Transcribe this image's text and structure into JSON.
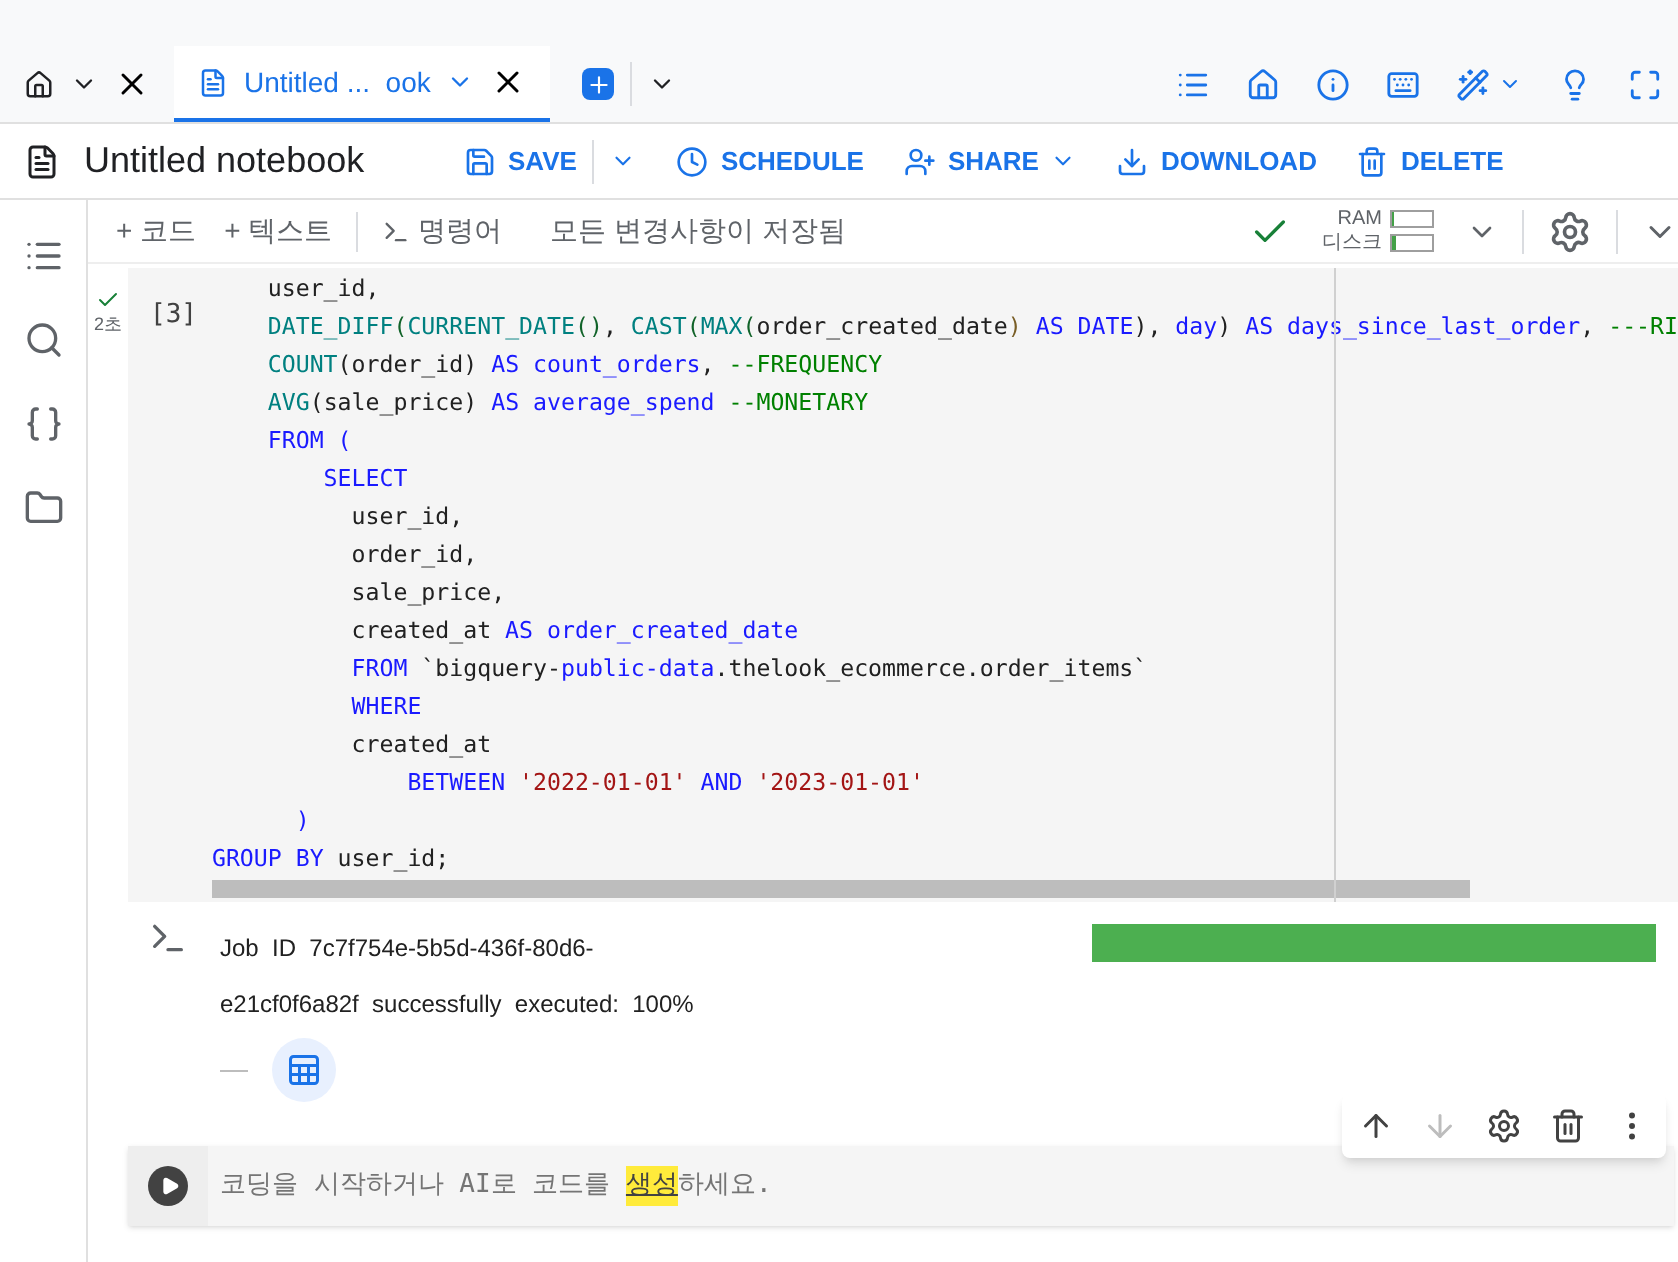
{
  "tabs": [
    {
      "kind": "home",
      "selected": false
    },
    {
      "kind": "notebook",
      "label": "Untitled ...  ook",
      "selected": true
    }
  ],
  "header": {
    "title": "Untitled notebook",
    "actions": [
      {
        "kind": "save",
        "label": "SAVE"
      },
      {
        "kind": "schedule",
        "label": "SCHEDULE"
      },
      {
        "kind": "share",
        "label": "SHARE"
      },
      {
        "kind": "download",
        "label": "DOWNLOAD"
      },
      {
        "kind": "delete",
        "label": "DELETE"
      }
    ]
  },
  "toolbar": {
    "add_code": "+ 코드",
    "add_text": "+ 텍스트",
    "command": "명령어",
    "save_status": "모든 변경사항이 저장됨",
    "ram_label": "RAM",
    "disk_label": "디스크",
    "ram": {
      "level": 0.05
    },
    "disk": {
      "level": 0.08
    }
  },
  "cell": {
    "run_time": "2초",
    "exec_count": "[3]",
    "lines": [
      [
        {
          "t": "    user_id,",
          "kind": "plain"
        }
      ],
      [
        {
          "t": "    DATE_DIFF",
          "kind": "func"
        },
        {
          "t": "(",
          "kind": "punct"
        },
        {
          "t": "CURRENT_DATE",
          "kind": "func"
        },
        {
          "t": "()",
          "kind": "punct"
        },
        {
          "t": ", ",
          "kind": "plain"
        },
        {
          "t": "CAST",
          "kind": "func"
        },
        {
          "t": "(",
          "kind": "punct"
        },
        {
          "t": "MAX",
          "kind": "func"
        },
        {
          "t": "(",
          "kind": "punct"
        },
        {
          "t": "order_created_date",
          "kind": "plain"
        },
        {
          "t": ")",
          "kind": "brace"
        },
        {
          "t": " AS DATE",
          "kind": "kw"
        },
        {
          "t": "), ",
          "kind": "plain"
        },
        {
          "t": "day",
          "kind": "kw"
        },
        {
          "t": ")",
          "kind": "plain"
        },
        {
          "t": " AS days_since_last_order",
          "kind": "kw"
        },
        {
          "t": ", ",
          "kind": "plain"
        },
        {
          "t": "---RI",
          "kind": "comment"
        }
      ],
      [
        {
          "t": "    COUNT",
          "kind": "func"
        },
        {
          "t": "(order_id)",
          "kind": "plain"
        },
        {
          "t": " AS count_orders",
          "kind": "kw"
        },
        {
          "t": ", ",
          "kind": "plain"
        },
        {
          "t": "--FREQUENCY",
          "kind": "comment"
        }
      ],
      [
        {
          "t": "    AVG",
          "kind": "func"
        },
        {
          "t": "(sale_price)",
          "kind": "plain"
        },
        {
          "t": " AS average_spend ",
          "kind": "kw"
        },
        {
          "t": "--MONETARY",
          "kind": "comment"
        }
      ],
      [
        {
          "t": "    FROM (",
          "kind": "kw"
        }
      ],
      [
        {
          "t": "        SELECT",
          "kind": "kw"
        }
      ],
      [
        {
          "t": "          user_id,",
          "kind": "plain"
        }
      ],
      [
        {
          "t": "          order_id,",
          "kind": "plain"
        }
      ],
      [
        {
          "t": "          sale_price,",
          "kind": "plain"
        }
      ],
      [
        {
          "t": "          created_at",
          "kind": "plain"
        },
        {
          "t": " AS order_created_date",
          "kind": "kw"
        }
      ],
      [
        {
          "t": "          FROM",
          "kind": "kw"
        },
        {
          "t": " `bigquery-",
          "kind": "plain"
        },
        {
          "t": "public-data",
          "kind": "kw"
        },
        {
          "t": ".thelook_ecommerce.order_items`",
          "kind": "plain"
        }
      ],
      [
        {
          "t": "          WHERE",
          "kind": "kw"
        }
      ],
      [
        {
          "t": "          created_at",
          "kind": "plain"
        }
      ],
      [
        {
          "t": "              BETWEEN ",
          "kind": "kw"
        },
        {
          "t": "'2022-01-01'",
          "kind": "string"
        },
        {
          "t": " AND ",
          "kind": "kw"
        },
        {
          "t": "'2023-01-01'",
          "kind": "string"
        }
      ],
      [
        {
          "t": "      )",
          "kind": "kw"
        }
      ],
      [
        {
          "t": "GROUP BY",
          "kind": "kw"
        },
        {
          "t": " user_id;",
          "kind": "plain"
        }
      ]
    ],
    "output": {
      "lines": [
        "Job  ID  7c7f754e-5b5d-436f-80d6-",
        "e21cf0f6a82f  successfully  executed:  100%"
      ],
      "progress": {
        "level": 1
      }
    }
  },
  "empty_cell": {
    "prompt_before": "코딩을 시작하거나 AI로 코드를 ",
    "prompt_link": "생성",
    "prompt_after": "하세요."
  }
}
